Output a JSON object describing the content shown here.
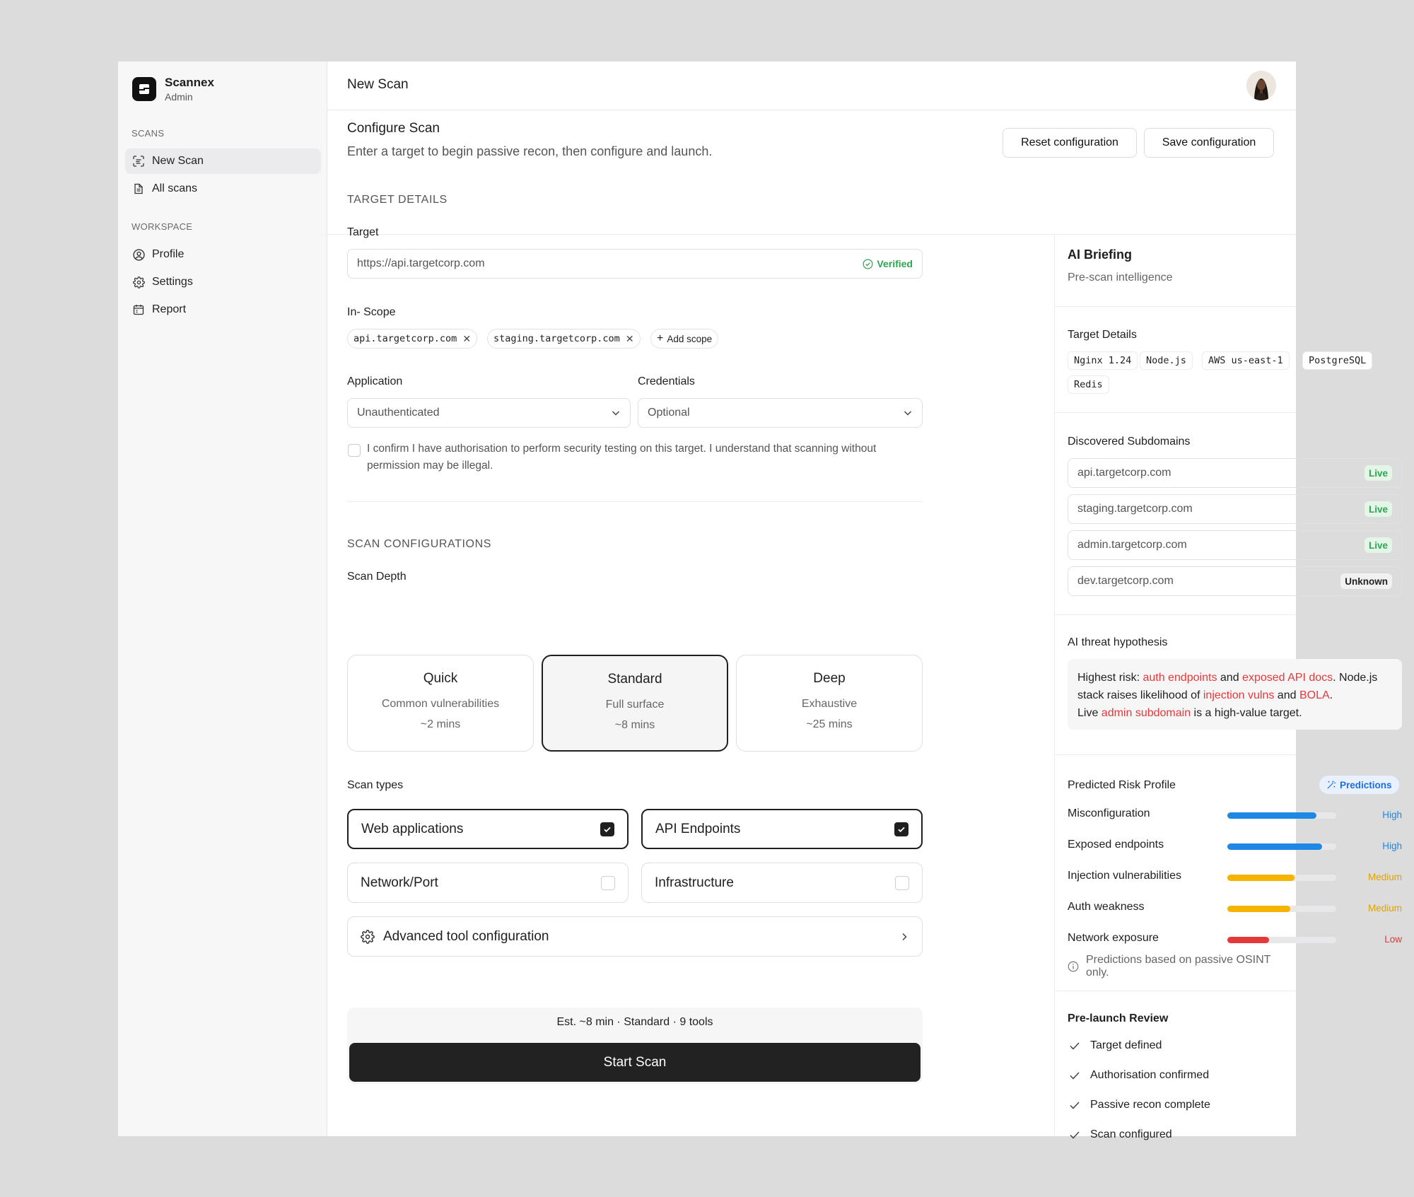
{
  "brand": {
    "name": "Scannex",
    "role": "Admin"
  },
  "sidebar": {
    "scans_section": "SCANS",
    "scans_items": [
      {
        "label": "New Scan",
        "icon": "scan-icon",
        "active": true
      },
      {
        "label": "All scans",
        "icon": "document-icon",
        "active": false
      }
    ],
    "workspace_section": "WORKSPACE",
    "workspace_items": [
      {
        "label": "Profile",
        "icon": "user-circle-icon"
      },
      {
        "label": "Settings",
        "icon": "gear-icon"
      },
      {
        "label": "Report",
        "icon": "calendar-icon"
      }
    ]
  },
  "topbar": {
    "title": "New Scan"
  },
  "configure": {
    "title": "Configure Scan",
    "subtitle": "Enter a target to begin passive recon, then configure and launch.",
    "reset_label": "Reset configuration",
    "save_label": "Save configuration"
  },
  "target_details": {
    "section_title": "TARGET DETAILS",
    "target_label": "Target",
    "target_value": "https://api.targetcorp.com",
    "verified_label": "Verified",
    "scope_label": "In- Scope",
    "scopes": [
      "api.targetcorp.com",
      "staging.targetcorp.com"
    ],
    "add_scope_label": "Add scope",
    "application_label": "Application",
    "application_value": "Unauthenticated",
    "credentials_label": "Credentials",
    "credentials_value": "Optional",
    "consent_text": "I confirm I have authorisation to perform security testing on this target. I understand that scanning without permission may be illegal.",
    "consent_checked": false
  },
  "scan_config": {
    "section_title": "SCAN CONFIGURATIONS",
    "depth_label": "Scan Depth",
    "depths": [
      {
        "name": "Quick",
        "desc": "Common vulnerabilities",
        "time": "~2 mins",
        "selected": false
      },
      {
        "name": "Standard",
        "desc": "Full surface",
        "time": "~8 mins",
        "selected": true
      },
      {
        "name": "Deep",
        "desc": "Exhaustive",
        "time": "~25 mins",
        "selected": false
      }
    ],
    "types_label": "Scan types",
    "types": [
      {
        "name": "Web applications",
        "checked": true
      },
      {
        "name": "API Endpoints",
        "checked": true
      },
      {
        "name": "Network/Port",
        "checked": false
      },
      {
        "name": "Infrastructure",
        "checked": false
      }
    ],
    "advanced_label": "Advanced tool configuration"
  },
  "launch": {
    "estimate": "Est. ~8 min · Standard · 9 tools",
    "start_label": "Start Scan"
  },
  "briefing": {
    "title": "AI Briefing",
    "subtitle": "Pre-scan intelligence",
    "target_details_title": "Target Details",
    "tech_tags": [
      "Nginx 1.24",
      "Node.js",
      "AWS us-east-1",
      "PostgreSQL",
      "Redis"
    ],
    "subdomains_title": "Discovered Subdomains",
    "subdomains": [
      {
        "host": "api.targetcorp.com",
        "status": "Live"
      },
      {
        "host": "staging.targetcorp.com",
        "status": "Live"
      },
      {
        "host": "admin.targetcorp.com",
        "status": "Live"
      },
      {
        "host": "dev.targetcorp.com",
        "status": "Unknown"
      }
    ],
    "hypothesis_title": "AI threat hypothesis",
    "hypothesis": {
      "t1": "Highest risk: ",
      "h1": "auth endpoints",
      "t2": " and ",
      "h2": "exposed API docs",
      "t3": ". Node.js stack raises likelihood of ",
      "h3": "injection vulns",
      "t4": " and ",
      "h4": "BOLA",
      "t5": ".",
      "t6": "Live ",
      "h5": "admin subdomain",
      "t7": " is a high-value target."
    },
    "risk_title": "Predicted Risk Profile",
    "predictions_badge": "Predictions",
    "risks": [
      {
        "name": "Misconfiguration",
        "level": "High",
        "fill": 0.82,
        "color": "#1e88e5"
      },
      {
        "name": "Exposed endpoints",
        "level": "High",
        "fill": 0.87,
        "color": "#1e88e5"
      },
      {
        "name": "Injection vulnerabilities",
        "level": "Medium",
        "fill": 0.62,
        "color": "#f5b400"
      },
      {
        "name": "Auth weakness",
        "level": "Medium",
        "fill": 0.58,
        "color": "#f5b400"
      },
      {
        "name": "Network exposure",
        "level": "Low",
        "fill": 0.38,
        "color": "#e5383b"
      }
    ],
    "predictions_note": "Predictions based on passive OSINT only.",
    "review_title": "Pre-launch Review",
    "review_items": [
      "Target defined",
      "Authorisation confirmed",
      "Passive recon complete",
      "Scan configured"
    ]
  }
}
